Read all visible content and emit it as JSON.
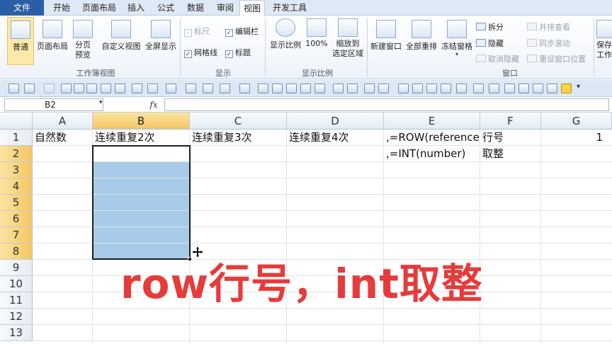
{
  "menu": {
    "tabs": [
      "文件",
      "开始",
      "页面布局",
      "插入",
      "公式",
      "数据",
      "审阅",
      "视图",
      "开发工具"
    ],
    "active_tab": "视图"
  },
  "ribbon": {
    "workbook_views": {
      "label": "工作簿视图",
      "normal": "普通",
      "page_layout": "页面布局",
      "page_break_preview": [
        "分页",
        "预览"
      ],
      "custom_views": "自定义视图",
      "full_screen": "全屏显示"
    },
    "show": {
      "label": "显示",
      "ruler": "标尺",
      "formula_bar": "编辑栏",
      "gridlines": "网格线",
      "headings": "标题"
    },
    "zoom": {
      "label": "显示比例",
      "zoom": "显示比例",
      "hundred": "100%",
      "zoom_to_selection": [
        "缩放到",
        "选定区域"
      ]
    },
    "window": {
      "label": "窗口",
      "new_window": "新建窗口",
      "arrange_all": "全部重排",
      "freeze_panes": "冻结窗格",
      "split": "拆分",
      "hide": "隐藏",
      "unhide": "取消隐藏",
      "view_side_by_side": "并排查看",
      "sync_scroll": "同步滚动",
      "reset_position": "重设窗口位置",
      "save_workspace": [
        "保存",
        "工作"
      ]
    }
  },
  "formula_bar": {
    "name_box": "B2",
    "fx": "fx",
    "content": ""
  },
  "sheet": {
    "columns": [
      "A",
      "B",
      "C",
      "D",
      "E",
      "F",
      "G"
    ],
    "selected_column": "B",
    "rows": [
      "1",
      "2",
      "3",
      "4",
      "5",
      "6",
      "7",
      "8",
      "9",
      "10",
      "11",
      "12",
      "13"
    ],
    "selected_rows": [
      "2",
      "3",
      "4",
      "5",
      "6",
      "7",
      "8"
    ],
    "cells": {
      "A1": "自然数",
      "B1": "连续重复2次",
      "C1": "连续重复3次",
      "D1": "连续重复4次",
      "E1": ",=ROW(reference",
      "F1": "行号",
      "G1": "1",
      "E2": ",=INT(number)",
      "F2": "取整"
    }
  },
  "overlay": {
    "caption": "row行号，int取整",
    "color": "#e63b3b"
  },
  "colors": {
    "file_tab": "#2a5fa8",
    "selection_fill": "#a9cbea",
    "header_highlight": "#f3c762"
  }
}
